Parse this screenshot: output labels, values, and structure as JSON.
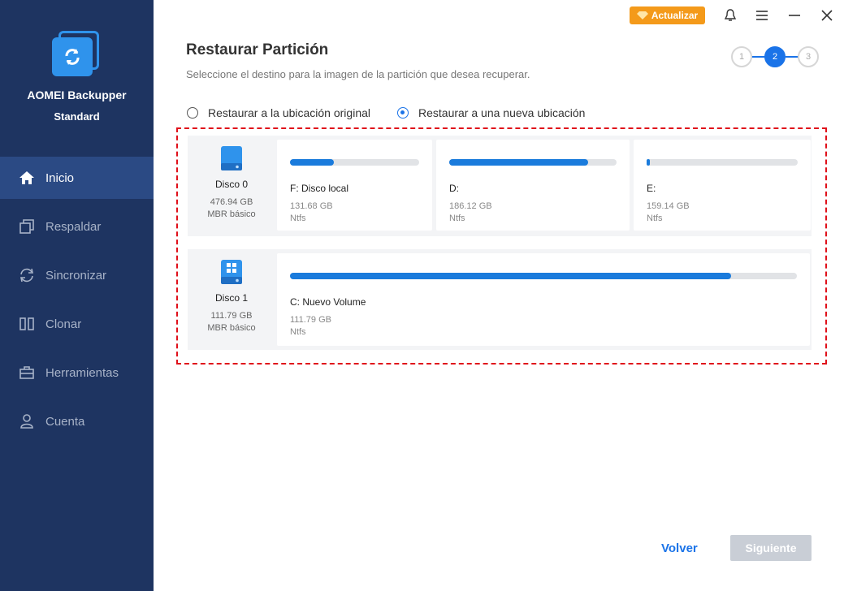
{
  "app": {
    "name": "AOMEI Backupper",
    "edition": "Standard"
  },
  "sidebar": {
    "items": [
      {
        "label": "Inicio",
        "icon": "home-icon"
      },
      {
        "label": "Respaldar",
        "icon": "backup-icon"
      },
      {
        "label": "Sincronizar",
        "icon": "sync-icon"
      },
      {
        "label": "Clonar",
        "icon": "clone-icon"
      },
      {
        "label": "Herramientas",
        "icon": "toolbox-icon"
      },
      {
        "label": "Cuenta",
        "icon": "user-icon"
      }
    ],
    "active_index": 0
  },
  "topbar": {
    "upgrade_label": "Actualizar"
  },
  "header": {
    "title": "Restaurar Partición",
    "subtitle": "Seleccione el destino para la imagen de la partición que desea recuperar."
  },
  "stepper": {
    "steps": [
      "1",
      "2",
      "3"
    ],
    "current": 2
  },
  "restore_options": {
    "original": "Restaurar a la ubicación original",
    "new": "Restaurar a una nueva ubicación",
    "selected": "new"
  },
  "disks": [
    {
      "name": "Disco 0",
      "size": "476.94 GB",
      "type": "MBR básico",
      "partitions": [
        {
          "name": "F: Disco local",
          "size": "131.68 GB",
          "fs": "Ntfs",
          "used_fraction": 0.34
        },
        {
          "name": "D:",
          "size": "186.12 GB",
          "fs": "Ntfs",
          "used_fraction": 0.83
        },
        {
          "name": "E:",
          "size": "159.14 GB",
          "fs": "Ntfs",
          "used_fraction": 0.02
        }
      ]
    },
    {
      "name": "Disco 1",
      "size": "111.79 GB",
      "type": "MBR básico",
      "partitions": [
        {
          "name": "C: Nuevo Volume",
          "size": "111.79 GB",
          "fs": "Ntfs",
          "used_fraction": 0.87
        }
      ]
    }
  ],
  "footer": {
    "back_label": "Volver",
    "next_label": "Siguiente"
  },
  "colors": {
    "sidebar": "#1e3461",
    "accent": "#1a73e8",
    "upgrade": "#f49a1a",
    "highlight_border": "#e0101a"
  }
}
